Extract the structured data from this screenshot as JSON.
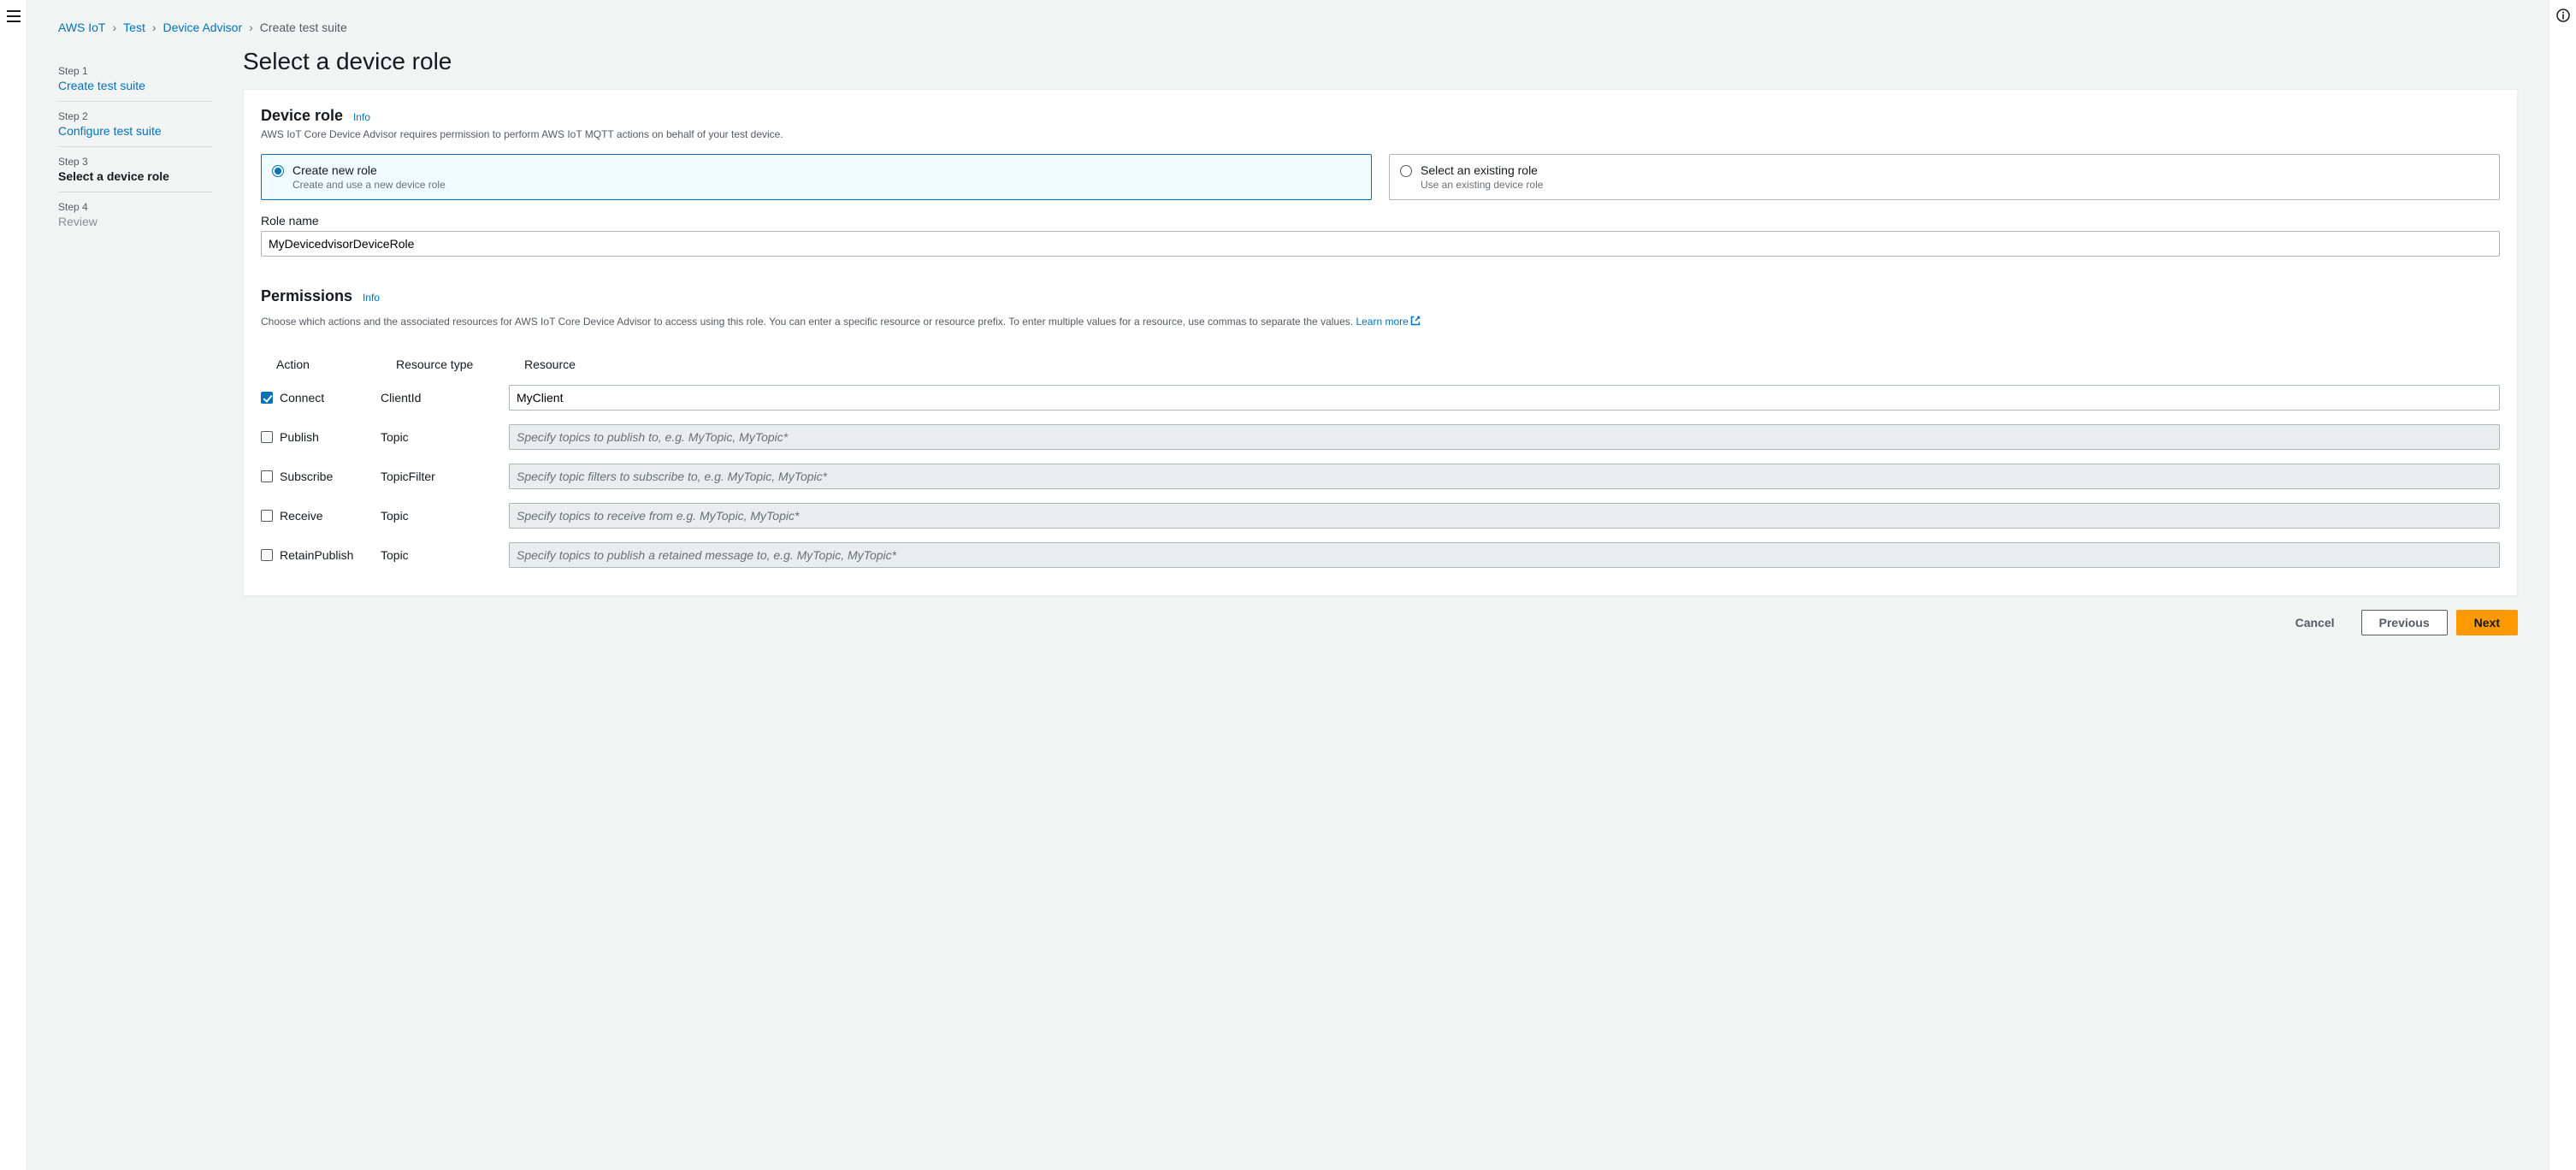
{
  "breadcrumbs": {
    "items": [
      "AWS IoT",
      "Test",
      "Device Advisor"
    ],
    "current": "Create test suite"
  },
  "wizard": {
    "steps": [
      {
        "label": "Step 1",
        "title": "Create test suite"
      },
      {
        "label": "Step 2",
        "title": "Configure test suite"
      },
      {
        "label": "Step 3",
        "title": "Select a device role"
      },
      {
        "label": "Step 4",
        "title": "Review"
      }
    ]
  },
  "page": {
    "title": "Select a device role"
  },
  "deviceRole": {
    "heading": "Device role",
    "info": "Info",
    "description": "AWS IoT Core Device Advisor requires permission to perform AWS IoT MQTT actions on behalf of your test device.",
    "options": {
      "create": {
        "title": "Create new role",
        "desc": "Create and use a new device role"
      },
      "existing": {
        "title": "Select an existing role",
        "desc": "Use an existing device role"
      }
    },
    "roleNameLabel": "Role name",
    "roleNameValue": "MyDevicedvisorDeviceRole"
  },
  "permissions": {
    "heading": "Permissions",
    "info": "Info",
    "description": "Choose which actions and the associated resources for AWS IoT Core Device Advisor to access using this role. You can enter a specific resource or resource prefix. To enter multiple values for a resource, use commas to separate the values.",
    "learnMore": "Learn more",
    "columns": {
      "action": "Action",
      "resType": "Resource type",
      "resource": "Resource"
    },
    "rows": [
      {
        "checked": true,
        "action": "Connect",
        "resType": "ClientId",
        "value": "MyClient",
        "placeholder": ""
      },
      {
        "checked": false,
        "action": "Publish",
        "resType": "Topic",
        "value": "",
        "placeholder": "Specify topics to publish to, e.g. MyTopic, MyTopic*"
      },
      {
        "checked": false,
        "action": "Subscribe",
        "resType": "TopicFilter",
        "value": "",
        "placeholder": "Specify topic filters to subscribe to, e.g. MyTopic, MyTopic*"
      },
      {
        "checked": false,
        "action": "Receive",
        "resType": "Topic",
        "value": "",
        "placeholder": "Specify topics to receive from e.g. MyTopic, MyTopic*"
      },
      {
        "checked": false,
        "action": "RetainPublish",
        "resType": "Topic",
        "value": "",
        "placeholder": "Specify topics to publish a retained message to, e.g. MyTopic, MyTopic*"
      }
    ]
  },
  "footer": {
    "cancel": "Cancel",
    "previous": "Previous",
    "next": "Next"
  }
}
